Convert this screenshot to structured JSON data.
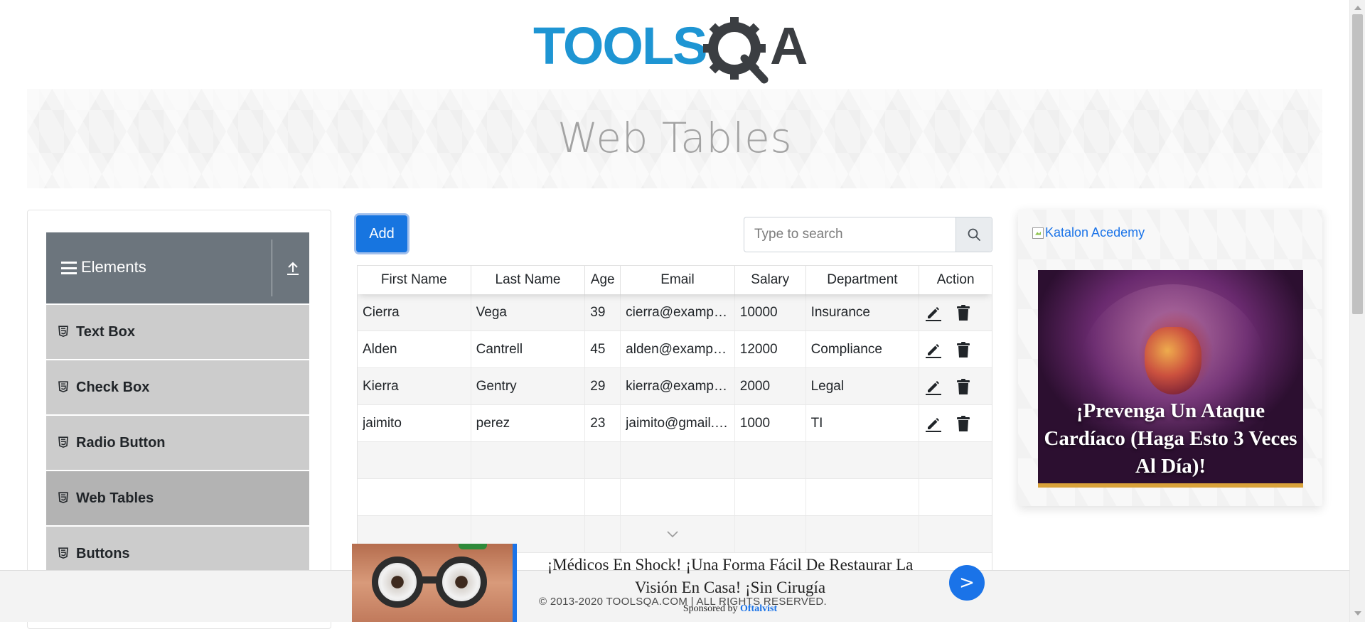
{
  "header": {
    "logo_text": "TOOLSQA",
    "logo_colors": {
      "tools": "#1e95d3",
      "qa": "#3b3e42"
    }
  },
  "banner": {
    "title": "Web Tables"
  },
  "sidebar": {
    "group_title": "Elements",
    "items": [
      {
        "label": "Text Box",
        "active": false
      },
      {
        "label": "Check Box",
        "active": false
      },
      {
        "label": "Radio Button",
        "active": false
      },
      {
        "label": "Web Tables",
        "active": true
      },
      {
        "label": "Buttons",
        "active": false
      }
    ]
  },
  "toolbar": {
    "add_label": "Add",
    "search_placeholder": "Type to search"
  },
  "table": {
    "columns": [
      "First Name",
      "Last Name",
      "Age",
      "Email",
      "Salary",
      "Department",
      "Action"
    ],
    "rows": [
      [
        "Cierra",
        "Vega",
        "39",
        "cierra@example.com",
        "10000",
        "Insurance"
      ],
      [
        "Alden",
        "Cantrell",
        "45",
        "alden@example.com",
        "12000",
        "Compliance"
      ],
      [
        "Kierra",
        "Gentry",
        "29",
        "kierra@example.com",
        "2000",
        "Legal"
      ],
      [
        "jaimito",
        "perez",
        "23",
        "jaimito@gmail.com",
        "1000",
        "TI"
      ]
    ]
  },
  "right_ad": {
    "link_text": "Katalon Acedemy",
    "headline": "¡Prevenga Un Ataque Cardíaco (Haga Esto 3 Veces Al Día)!"
  },
  "footer": {
    "copyright": "© 2013-2020 TOOLSQA.COM | ALL RIGHTS RESERVED."
  },
  "bottom_ad": {
    "headline": "¡Médicos En Shock! ¡Una Forma Fácil De Restaurar La Visión En Casa! ¡Sin Cirugía",
    "sponsored_prefix": "Sponsored by",
    "sponsor_name": "Oftalvist",
    "cta_label": ">"
  },
  "colors": {
    "primary": "#1775e0",
    "sidebar_header": "#6c757d",
    "sidebar_item": "#cccccc",
    "sidebar_item_active": "#b3b3b3",
    "title_gray": "#a3a3a3"
  }
}
